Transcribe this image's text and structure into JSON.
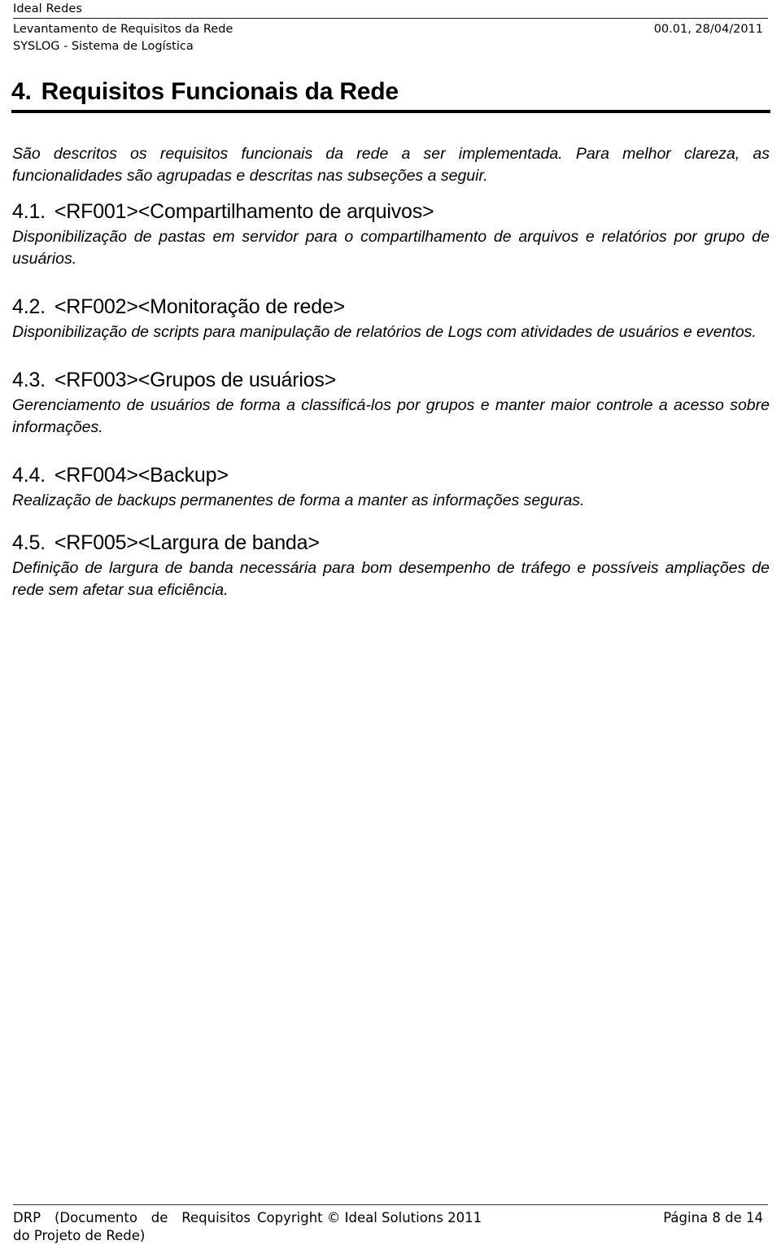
{
  "header": {
    "company": "Ideal Redes",
    "doc_title": "Levantamento de Requisitos da Rede",
    "system": "SYSLOG - Sistema de Logística",
    "version_date": "00.01, 28/04/2011"
  },
  "section": {
    "number": "4.",
    "title": "Requisitos Funcionais da Rede",
    "intro": "São descritos os requisitos funcionais da rede a ser implementada. Para melhor clareza, as funcionalidades são agrupadas e descritas nas subseções a seguir."
  },
  "subsections": [
    {
      "number": "4.1.",
      "heading": "<RF001><Compartilhamento de arquivos>",
      "body": "Disponibilização de pastas em servidor para o compartilhamento de arquivos e relatórios por grupo de usuários."
    },
    {
      "number": "4.2.",
      "heading": "<RF002><Monitoração de rede>",
      "body": "Disponibilização de scripts para manipulação de relatórios de Logs com atividades de usuários e eventos."
    },
    {
      "number": "4.3.",
      "heading": "<RF003><Grupos de usuários>",
      "body": "Gerenciamento de usuários de forma a classificá-los por grupos e manter maior controle a acesso sobre informações."
    },
    {
      "number": "4.4.",
      "heading": "<RF004><Backup>",
      "body": "Realização de backups permanentes de forma a manter as informações seguras."
    },
    {
      "number": "4.5.",
      "heading": "<RF005><Largura de banda>",
      "body": "Definição de largura de banda necessária para bom desempenho de tráfego e possíveis ampliações de rede sem afetar sua eficiência."
    }
  ],
  "footer": {
    "doc_ref_line1": "DRP (Documento de Requisitos",
    "doc_ref_line2": "do Projeto de Rede)",
    "copyright": "Copyright © Ideal Solutions 2011",
    "page_info": "Página 8 de 14"
  }
}
